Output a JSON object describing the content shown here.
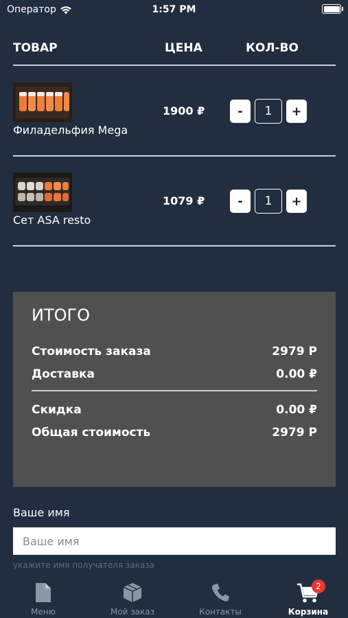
{
  "status_bar": {
    "carrier": "Оператор",
    "time": "1:57 PM"
  },
  "table": {
    "headers": {
      "product": "ТОВАР",
      "price": "ЦЕНА",
      "qty": "КОЛ-ВО"
    },
    "items": [
      {
        "name": "Филадельфия Mega",
        "price": "1900 ₽",
        "qty": "1",
        "minus": "-",
        "plus": "+"
      },
      {
        "name": "Сет ASA resto",
        "price": "1079 ₽",
        "qty": "1",
        "minus": "-",
        "plus": "+"
      }
    ]
  },
  "summary": {
    "title": "ИТОГО",
    "order_cost_label": "Стоимость заказа",
    "order_cost_value": "2979 Р",
    "delivery_label": "Доставка",
    "delivery_value": "0.00 ₽",
    "discount_label": "Скидка",
    "discount_value": "0.00 ₽",
    "total_label": "Общая стоимость",
    "total_value": "2979 Р"
  },
  "form": {
    "name_label": "Ваше имя",
    "name_placeholder": "Ваше имя",
    "name_hint": "укажите имя получателя заказа"
  },
  "tabbar": {
    "tabs": [
      {
        "label": "Меню",
        "icon": "document-icon"
      },
      {
        "label": "Мой заказ",
        "icon": "box-icon"
      },
      {
        "label": "Контакты",
        "icon": "phone-icon"
      },
      {
        "label": "Корзина",
        "icon": "cart-icon",
        "badge": "2"
      }
    ]
  }
}
